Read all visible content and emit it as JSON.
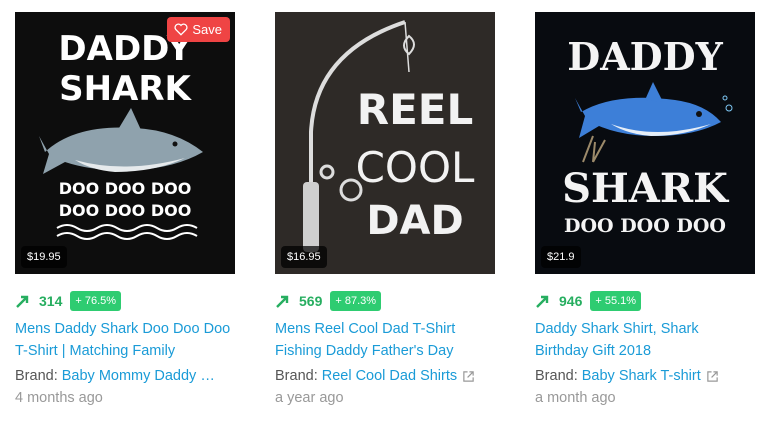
{
  "cards": [
    {
      "art": {
        "line1": "DADDY",
        "line2": "SHARK",
        "line3": "DOO DOO DOO",
        "line4": "DOO DOO DOO"
      },
      "price": "$19.95",
      "save_label": "Save",
      "count": "314",
      "pct": "+ 76.5%",
      "title": "Mens Daddy Shark Doo Doo Doo T-Shirt | Matching Family",
      "brand_label": "Brand:",
      "brand": "Baby Mommy Daddy …",
      "age": "4 months ago"
    },
    {
      "art": {
        "line1": "REEL",
        "line2": "COOL",
        "line3": "DAD"
      },
      "price": "$16.95",
      "count": "569",
      "pct": "+ 87.3%",
      "title": "Mens Reel Cool Dad T-Shirt Fishing Daddy Father's Day",
      "brand_label": "Brand:",
      "brand": "Reel Cool Dad Shirts",
      "age": "a year ago"
    },
    {
      "art": {
        "line1": "DADDY",
        "line2": "SHARK",
        "line3": "DOO DOO DOO"
      },
      "price": "$21.9",
      "count": "946",
      "pct": "+ 55.1%",
      "title": "Daddy Shark Shirt, Shark Birthday Gift 2018",
      "brand_label": "Brand:",
      "brand": "Baby Shark T-shirt",
      "age": "a month ago"
    }
  ],
  "colors": {
    "trend": "#27ae60",
    "link": "#1a9bd7",
    "badge": "#2ecc71",
    "save": "#ef4444"
  }
}
